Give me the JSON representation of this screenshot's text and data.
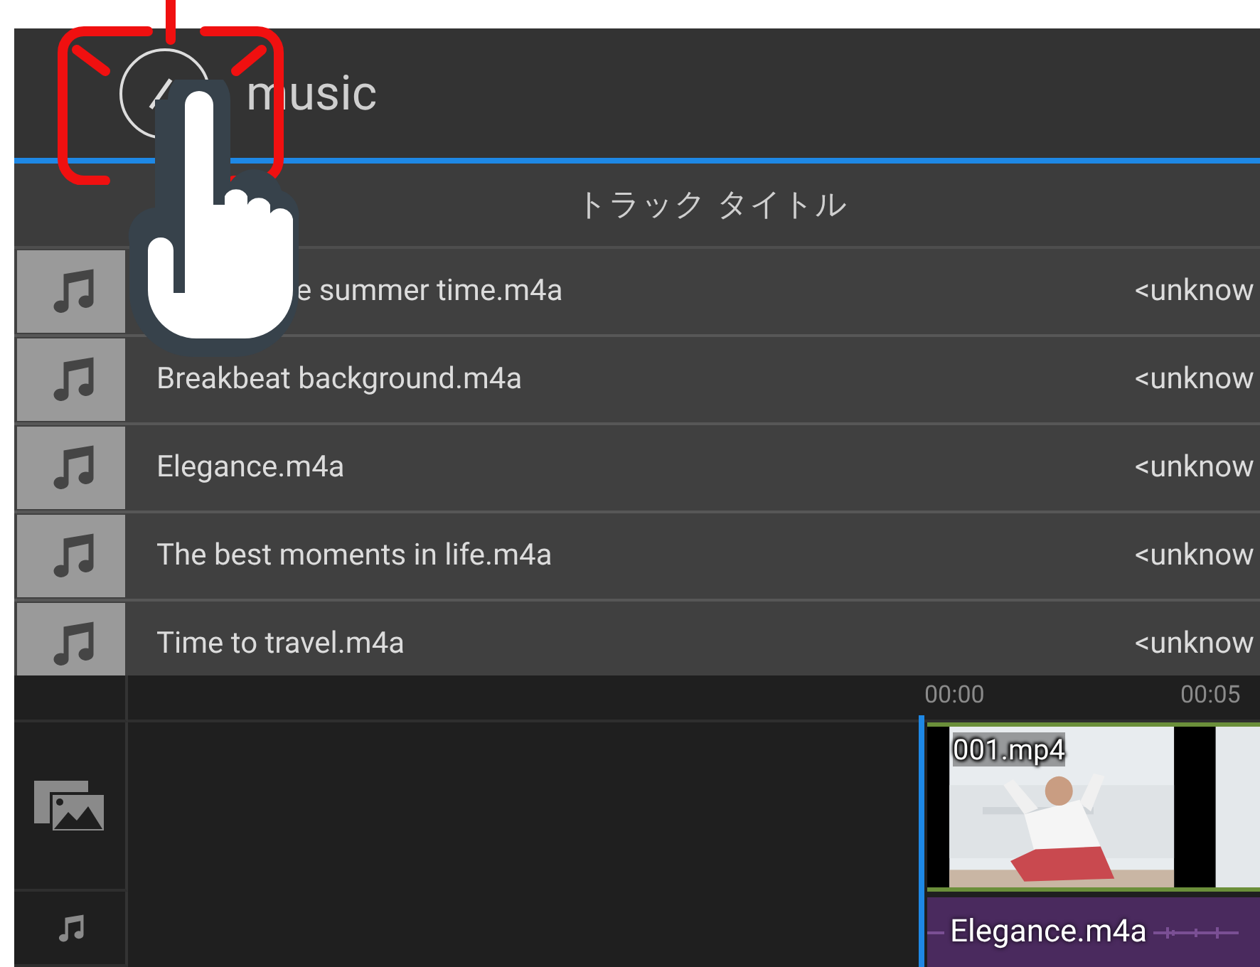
{
  "header": {
    "title": "music"
  },
  "column_header": {
    "label": "トラック タイトル"
  },
  "tracks": [
    {
      "title": "e summer time.m4a",
      "artist": "<unknow"
    },
    {
      "title": "Breakbeat background.m4a",
      "artist": "<unknow"
    },
    {
      "title": "Elegance.m4a",
      "artist": "<unknow"
    },
    {
      "title": "The best moments in life.m4a",
      "artist": "<unknow"
    },
    {
      "title": "Time to travel.m4a",
      "artist": "<unknow"
    }
  ],
  "timeline": {
    "ruler": [
      "00:00",
      "00:05"
    ],
    "video_clip": {
      "name": "001.mp4",
      "kind": "picture"
    },
    "audio_clip": {
      "name": "Elegance.m4a"
    }
  },
  "tutorial": {
    "pointer": true
  }
}
